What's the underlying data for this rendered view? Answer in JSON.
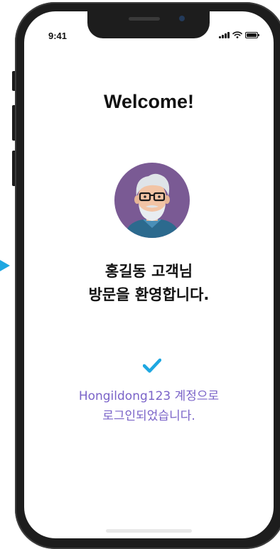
{
  "status_bar": {
    "time": "9:41"
  },
  "welcome": {
    "title": "Welcome!",
    "greeting_line1": "홍길동 고객님",
    "greeting_line2": "방문을 환영합니다."
  },
  "login": {
    "message_line1": "Hongildong123 계정으로",
    "message_line2": "로그인되었습니다."
  },
  "icons": {
    "avatar": "avatar-icon",
    "check": "check-icon",
    "signal": "signal-icon",
    "wifi": "wifi-icon",
    "battery": "battery-icon",
    "arrow": "arrow-right-icon"
  },
  "colors": {
    "accent_check": "#1ea7e1",
    "message_text": "#7a63c8",
    "avatar_bg": "#7a5a94",
    "phone_frame": "#1d1d1d"
  }
}
